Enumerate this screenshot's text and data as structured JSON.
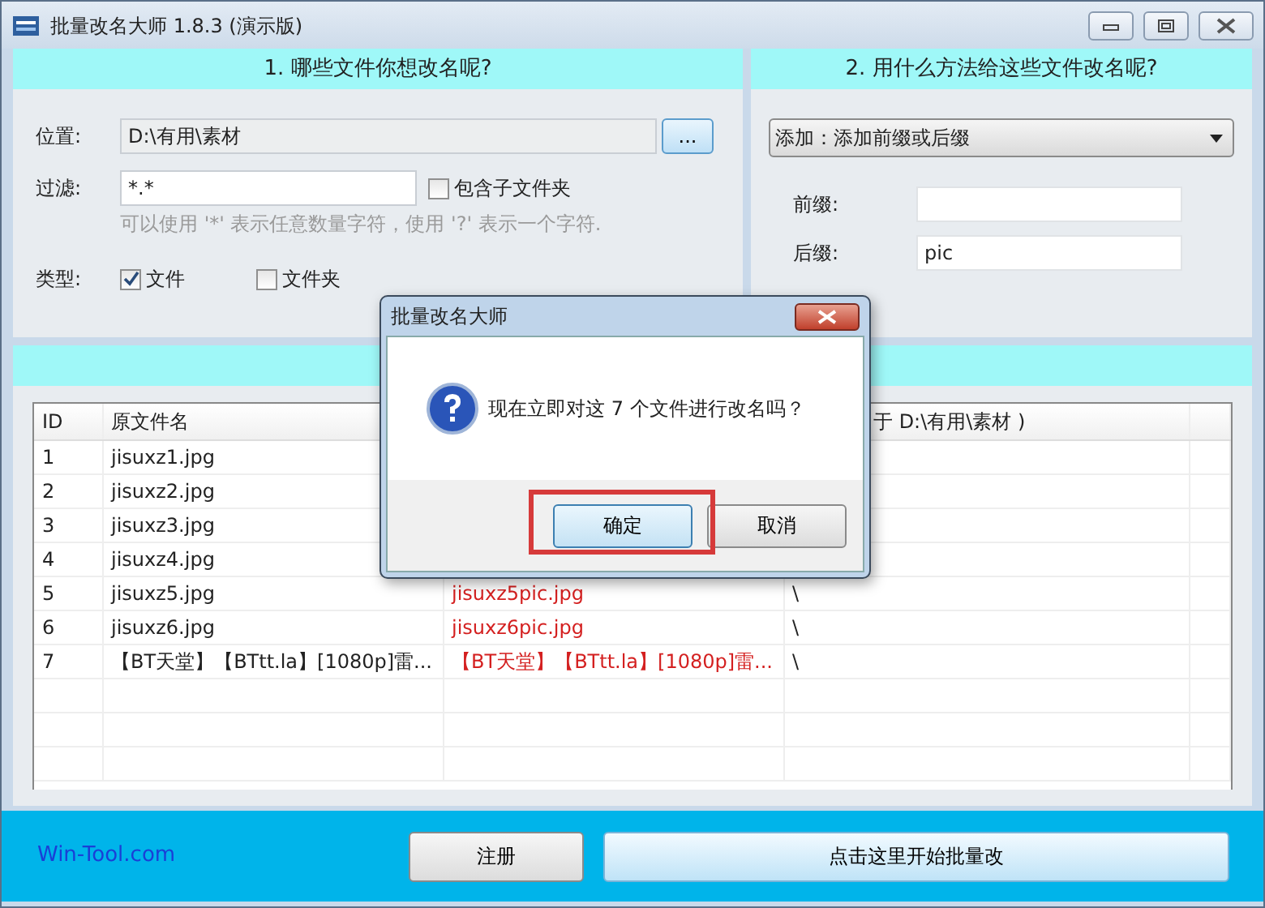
{
  "window": {
    "title": "批量改名大师 1.8.3 (演示版)"
  },
  "source_panel": {
    "heading": "1. 哪些文件你想改名呢?",
    "location_label": "位置:",
    "location_value": "D:\\有用\\素材",
    "browse_button": "...",
    "filter_label": "过滤:",
    "filter_value": "*.*",
    "include_subfolders": {
      "label": "包含子文件夹",
      "checked": false
    },
    "filter_hint": "可以使用 '*' 表示任意数量字符，使用 '?' 表示一个字符.",
    "type_label": "类型:",
    "types": [
      {
        "label": "文件",
        "checked": true
      },
      {
        "label": "文件夹",
        "checked": false
      }
    ]
  },
  "method_panel": {
    "heading": "2. 用什么方法给这些文件改名呢?",
    "method": "添加：添加前缀或后缀",
    "prefix_label": "前缀:",
    "suffix_label": "后缀:",
    "suffix_value": "pic"
  },
  "table": {
    "columns": [
      "ID",
      "原文件名",
      "于 D:\\有用\\素材 )"
    ],
    "rows": [
      {
        "id": "1",
        "original": "jisuxz1.jpg"
      },
      {
        "id": "2",
        "original": "jisuxz2.jpg"
      },
      {
        "id": "3",
        "original": "jisuxz3.jpg"
      },
      {
        "id": "4",
        "original": "jisuxz4.jpg"
      },
      {
        "id": "5",
        "original": "jisuxz5.jpg",
        "new_name": "jisuxz5pic.jpg",
        "column_4": "\\"
      },
      {
        "id": "6",
        "original": "jisuxz6.jpg",
        "new_name": "jisuxz6pic.jpg",
        "column_4": "\\"
      },
      {
        "id": "7",
        "original": "【BT天堂】【BTtt.la】[1080p]雷...",
        "new_name": "【BT天堂】【BTtt.la】[1080p]雷...",
        "column_4": "\\"
      }
    ]
  },
  "footer": {
    "link": "Win-Tool.com",
    "register_button": "注册",
    "start_button": "点击这里开始批量改"
  },
  "dialog": {
    "title": "批量改名大师",
    "message": "现在立即对这 7 个文件进行改名吗？",
    "buttons": [
      {
        "label": "确定",
        "highlighted": true
      },
      {
        "label": "取消",
        "highlighted": false
      }
    ]
  }
}
